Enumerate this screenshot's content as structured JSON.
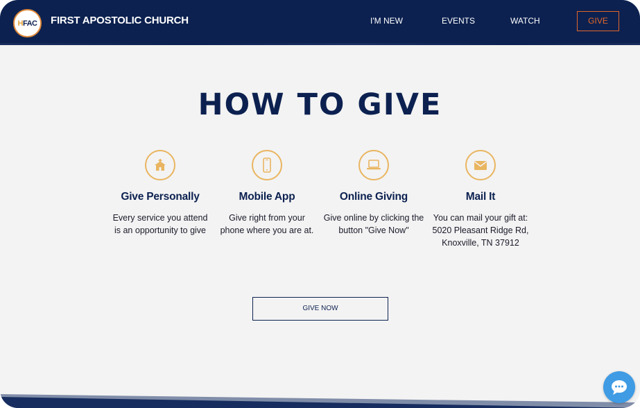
{
  "header": {
    "logo_text_a": "H",
    "logo_text_b": "FAC",
    "brand": "FIRST APOSTOLIC CHURCH",
    "nav": [
      "I'M NEW",
      "EVENTS",
      "WATCH"
    ],
    "give_button": "GIVE"
  },
  "main": {
    "heading": "HOW TO GIVE",
    "methods": [
      {
        "icon": "church-icon",
        "title": "Give Personally",
        "lines": [
          "Every service you attend",
          "is an opportunity to give"
        ]
      },
      {
        "icon": "phone-icon",
        "title": "Mobile App",
        "lines": [
          "Give right from your",
          "phone where you are at."
        ]
      },
      {
        "icon": "laptop-icon",
        "title": "Online Giving",
        "lines": [
          "Give online by clicking the",
          "button \"Give Now\""
        ]
      },
      {
        "icon": "envelope-icon",
        "title": "Mail It",
        "lines": [
          "You can mail your gift at:",
          "5020 Pleasant Ridge Rd,",
          "Knoxville, TN 37912"
        ]
      }
    ],
    "cta": "GIVE NOW"
  },
  "widgets": {
    "chat_icon": "chat-bubble-icon"
  },
  "colors": {
    "navy": "#0c2150",
    "orange": "#e2672b",
    "gold": "#e9b560",
    "background": "#f3f3f3",
    "chat_blue": "#3f9be4"
  }
}
